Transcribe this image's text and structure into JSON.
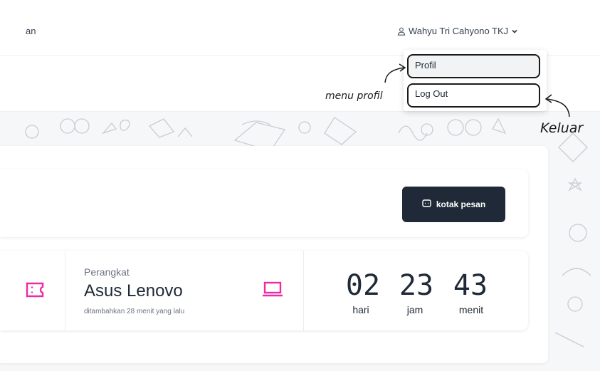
{
  "nav": {
    "left_text": "an",
    "user_name": "Wahyu Tri Cahyono TKJ"
  },
  "dropdown": {
    "profil_label": "Profil",
    "logout_label": "Log Out"
  },
  "annotations": {
    "menu_profil": "menu profil",
    "keluar": "Keluar"
  },
  "message": {
    "button_label": "kotak pesan"
  },
  "device": {
    "label": "Perangkat",
    "name": "Asus Lenovo",
    "added": "ditambahkan 28 menit yang lalu"
  },
  "countdown": {
    "days": "02",
    "hours": "23",
    "minutes": "43",
    "days_label": "hari",
    "hours_label": "jam",
    "minutes_label": "menit"
  },
  "colors": {
    "accent": "#ec2ba4",
    "dark_button": "#1f2937"
  }
}
